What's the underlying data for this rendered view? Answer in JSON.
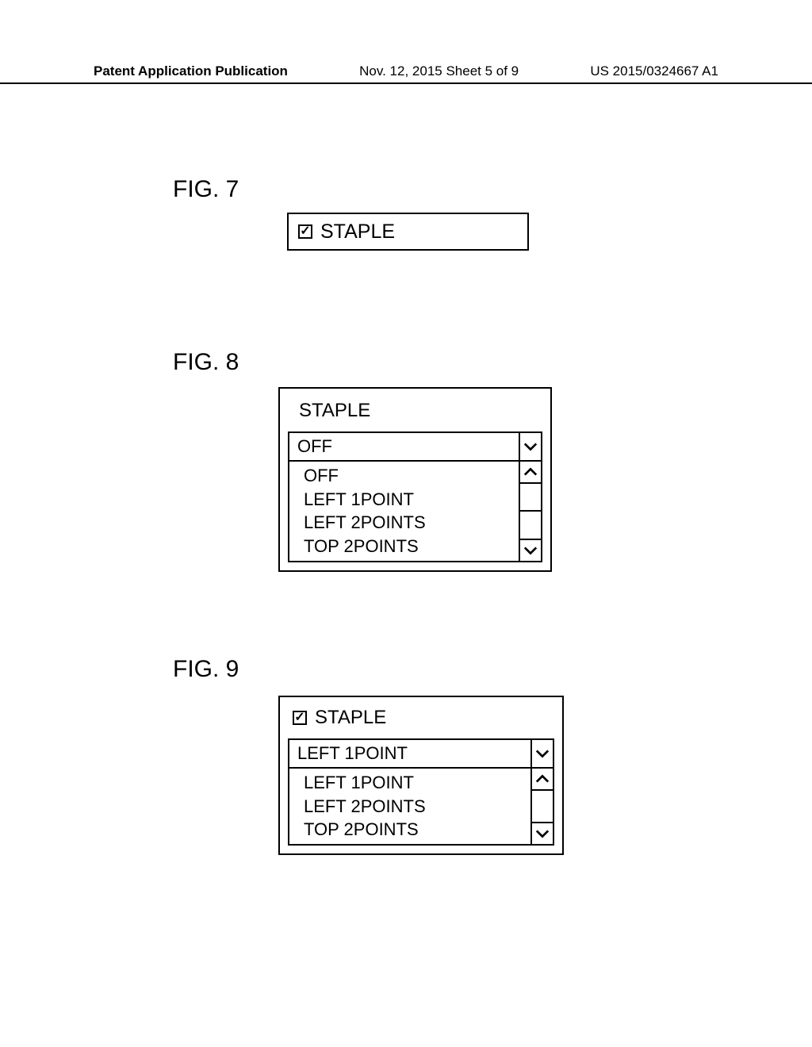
{
  "header": {
    "left": "Patent Application Publication",
    "center": "Nov. 12, 2015  Sheet 5 of 9",
    "right": "US 2015/0324667 A1"
  },
  "fig7": {
    "label": "FIG. 7",
    "checkbox_label": "STAPLE",
    "checked_glyph": "✓"
  },
  "fig8": {
    "label": "FIG. 8",
    "title": "STAPLE",
    "selected": "OFF",
    "options": [
      "OFF",
      "LEFT 1POINT",
      "LEFT 2POINTS",
      "TOP 2POINTS"
    ]
  },
  "fig9": {
    "label": "FIG. 9",
    "title": "STAPLE",
    "checked_glyph": "✓",
    "selected": "LEFT 1POINT",
    "options": [
      "LEFT 1POINT",
      "LEFT 2POINTS",
      "TOP 2POINTS"
    ]
  }
}
